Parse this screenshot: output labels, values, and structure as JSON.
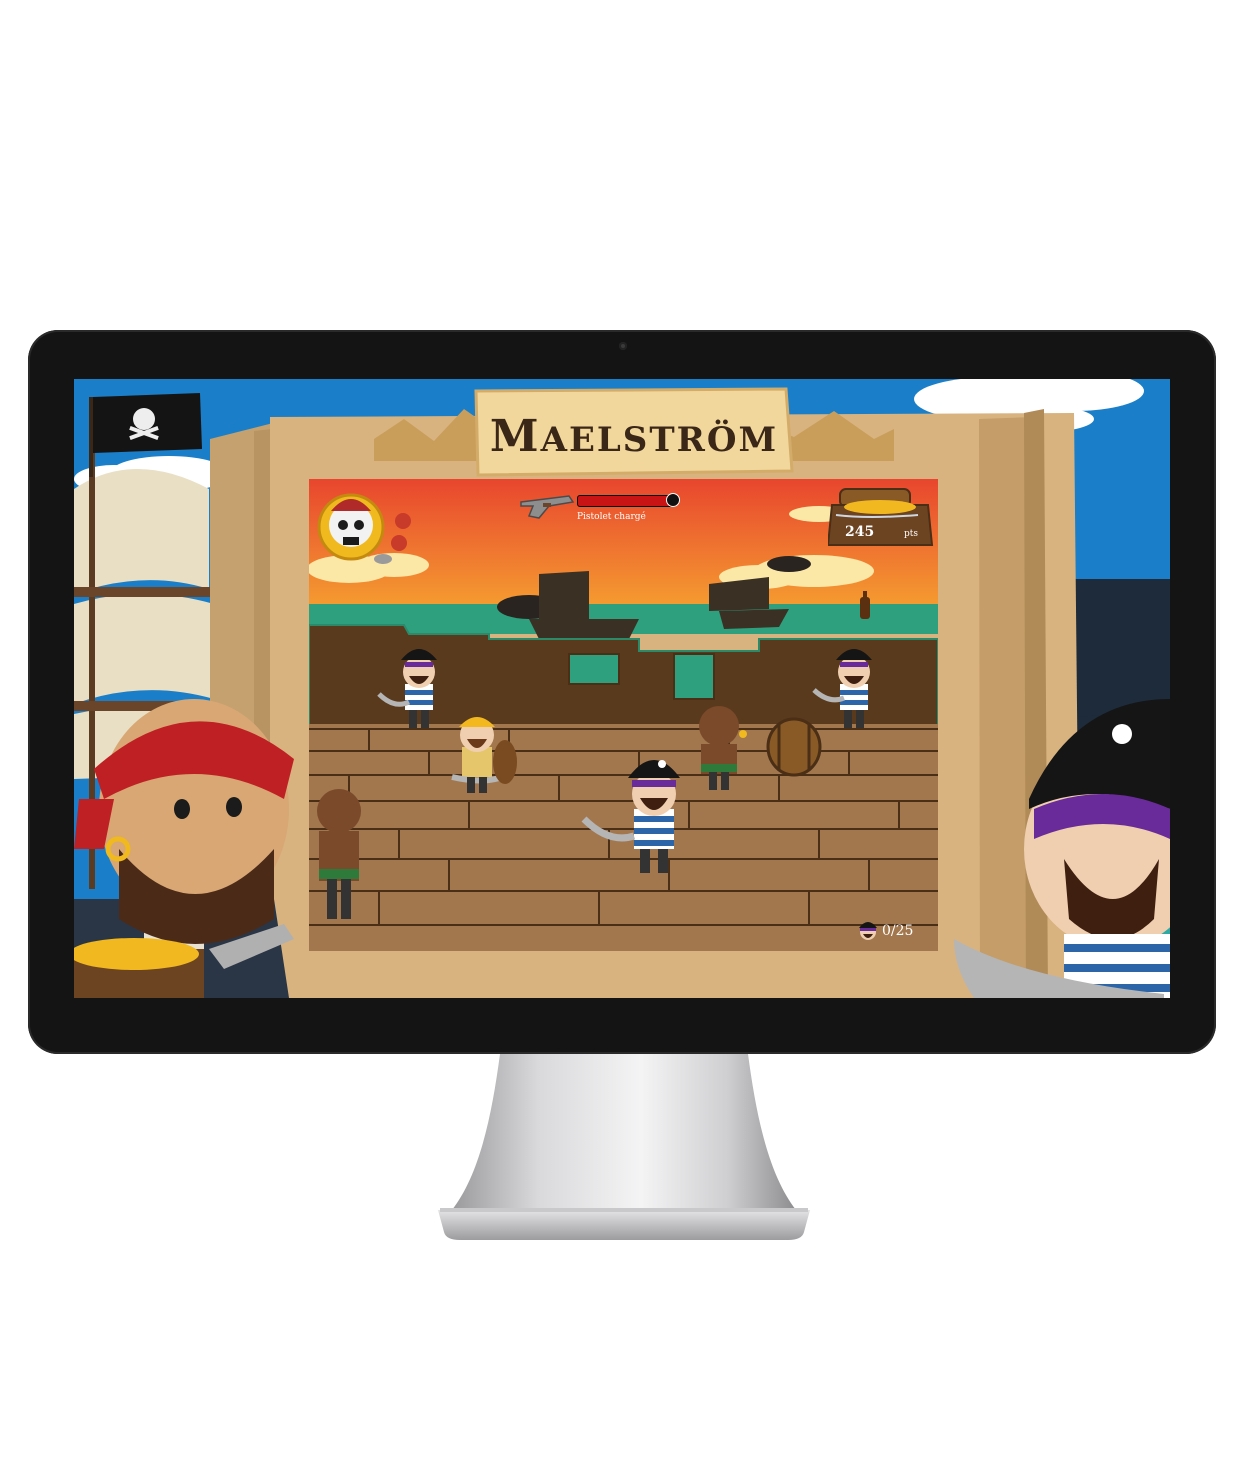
{
  "game": {
    "title_initial": "M",
    "title_rest": "AELSTRÖM",
    "weapon_status": "Pistolet chargé",
    "reload_fraction": 0.97,
    "score": "245",
    "score_unit": "pts",
    "kill_counter": "0/25"
  },
  "icons": [
    "pirate-flag-icon",
    "skull-emblem-icon",
    "flintlock-pistol-icon",
    "treasure-chest-icon",
    "pirate-head-icon",
    "rum-bottle-icon"
  ],
  "colors": {
    "sky": "#1a7fc8",
    "sunset_top": "#e8462e",
    "sunset_bottom": "#f6a431",
    "sea": "#2ea07e",
    "deck": "#a2774d",
    "parchment": "#d8b37f",
    "reload_bar": "#c81414"
  }
}
